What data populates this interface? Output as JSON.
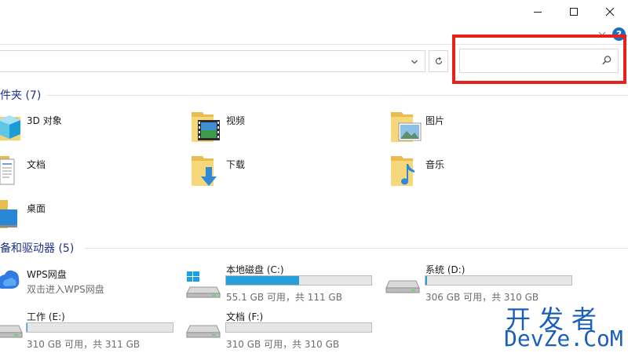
{
  "window_controls": {
    "minimize": "minimize-icon",
    "maximize": "maximize-icon",
    "close": "close-icon",
    "help_label": "?"
  },
  "address_bar": {
    "value": ""
  },
  "search": {
    "value": "",
    "highlight_color": "#e8211d"
  },
  "folders_section": {
    "title": "件夹 (7)",
    "items": [
      {
        "label": "3D 对象",
        "icon": "3d-objects-folder-icon"
      },
      {
        "label": "视频",
        "icon": "videos-folder-icon"
      },
      {
        "label": "图片",
        "icon": "pictures-folder-icon"
      },
      {
        "label": "文档",
        "icon": "documents-folder-icon"
      },
      {
        "label": "下载",
        "icon": "downloads-folder-icon"
      },
      {
        "label": "音乐",
        "icon": "music-folder-icon"
      },
      {
        "label": "桌面",
        "icon": "desktop-folder-icon"
      }
    ]
  },
  "drives_section": {
    "title": "备和驱动器 (5)",
    "items": [
      {
        "name": "WPS网盘",
        "sub": "双击进入WPS网盘",
        "icon": "wps-cloud-icon"
      },
      {
        "name": "本地磁盘 (C:)",
        "info": "55.1 GB 可用，共 111 GB",
        "used_fraction": 0.504,
        "icon": "windows-drive-icon"
      },
      {
        "name": "系统 (D:)",
        "info": "306 GB 可用，共 310 GB",
        "used_fraction": 0.013,
        "icon": "hard-drive-icon"
      },
      {
        "name": "工作 (E:)",
        "info": "310 GB 可用，共 311 GB",
        "used_fraction": 0.003,
        "icon": "hard-drive-icon"
      },
      {
        "name": "文档 (F:)",
        "info": "310 GB 可用，共 310 GB",
        "used_fraction": 0.0,
        "icon": "hard-drive-icon"
      }
    ]
  },
  "colors": {
    "accent": "#1e3287",
    "drive_fill": "#26a0da",
    "watermark": "#1a60b8"
  },
  "watermark": {
    "line1": "开发者",
    "line2": "DevZe.CoM"
  }
}
